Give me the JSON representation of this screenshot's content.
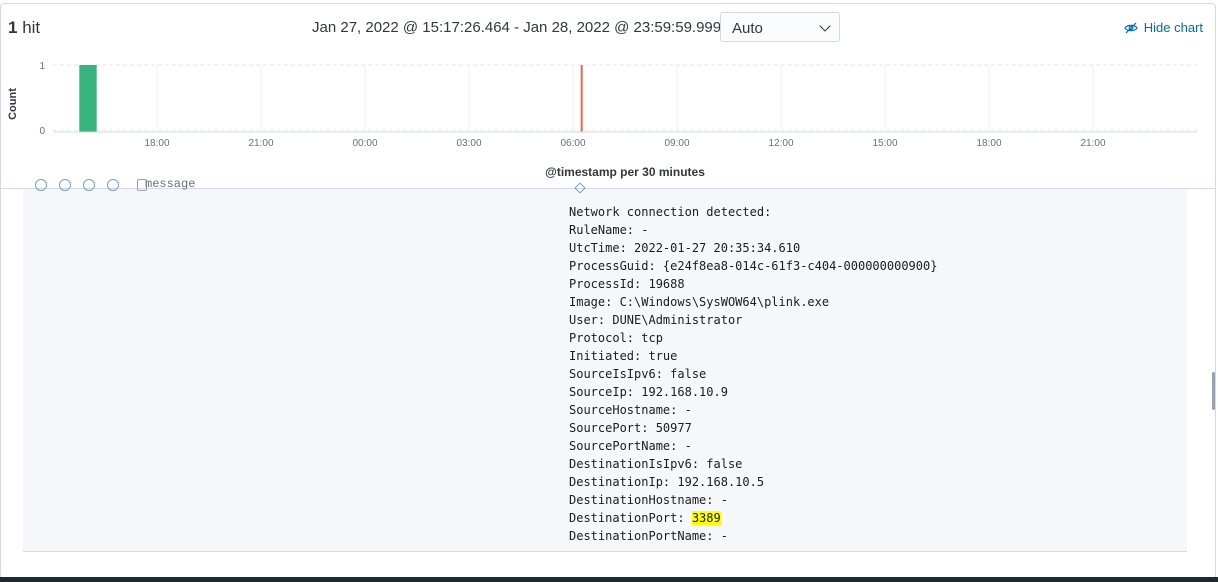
{
  "header": {
    "hit_count": "1",
    "hit_label": "hit",
    "time_range": "Jan 27, 2022 @ 15:17:26.464 - Jan 28, 2022 @ 23:59:59.999",
    "interval": "Auto",
    "hide_chart_label": "Hide chart",
    "hide_chart_icon": "eye-closed-icon"
  },
  "chart_data": {
    "type": "bar",
    "ylabel": "Count",
    "xlabel": "@timestamp per 30 minutes",
    "x_tick_labels": [
      "18:00",
      "21:00",
      "00:00",
      "03:00",
      "06:00",
      "09:00",
      "12:00",
      "15:00",
      "18:00",
      "21:00"
    ],
    "y_tick_labels": [
      "1",
      "0"
    ],
    "ylim": [
      0,
      1
    ],
    "bars": [
      {
        "x": "15:30",
        "value": 1
      }
    ],
    "bar_color": "#36b37e",
    "now_marker": {
      "x": "06:15",
      "color": "#e7664c"
    },
    "grid": true
  },
  "document": {
    "message_lines": [
      "Network connection detected:",
      "RuleName: -",
      "UtcTime: 2022-01-27 20:35:34.610",
      "ProcessGuid: {e24f8ea8-014c-61f3-c404-000000000900}",
      "ProcessId: 19688",
      "Image: C:\\Windows\\SysWOW64\\plink.exe",
      "User: DUNE\\Administrator",
      "Protocol: tcp",
      "Initiated: true",
      "SourceIsIpv6: false",
      "SourceIp: 192.168.10.9",
      "SourceHostname: -",
      "SourcePort: 50977",
      "SourcePortName: -",
      "DestinationIsIpv6: false",
      "DestinationIp: 192.168.10.5",
      "DestinationHostname: -"
    ],
    "dest_port_key": "DestinationPort: ",
    "dest_port_value": "3389",
    "dest_port_name_line": "DestinationPortName: -",
    "partial_field_label": "message"
  }
}
